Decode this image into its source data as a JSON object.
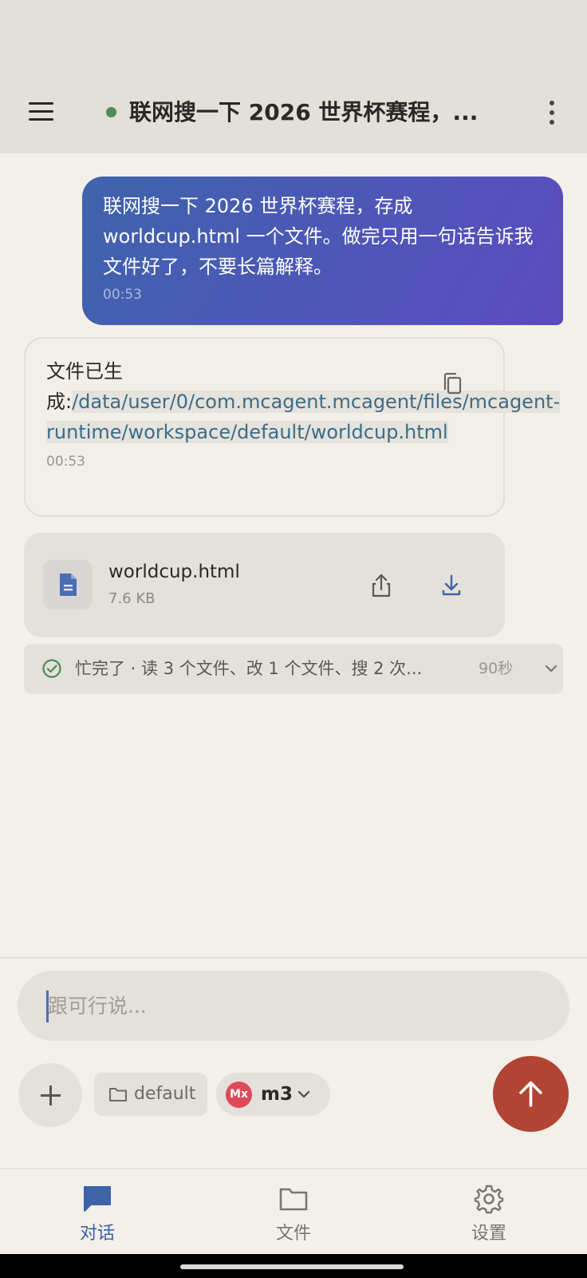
{
  "header": {
    "title": "联网搜一下 2026 世界杯赛程，...",
    "status_color": "#4f8a57"
  },
  "messages": {
    "user": {
      "text": "联网搜一下 2026 世界杯赛程，存成 worldcup.html 一个文件。做完只用一句话告诉我文件好了，不要长篇解释。",
      "time": "00:53"
    },
    "assistant": {
      "prefix": "文件已生成:",
      "path": "/data/user/0/com.mcagent.mcagent/files/mcagent-runtime/workspace/default/worldcup.html",
      "time": "00:53"
    }
  },
  "file_card": {
    "name": "worldcup.html",
    "size": "7.6 KB"
  },
  "activity": {
    "text": "忙完了 · 读 3 个文件、改 1 个文件、搜 2 次...",
    "duration": "90秒"
  },
  "composer": {
    "placeholder": "跟可行说..."
  },
  "toolbar": {
    "workspace": "default",
    "model_badge": "Mx",
    "model_name": "m3"
  },
  "nav": {
    "chat": "对话",
    "files": "文件",
    "settings": "设置"
  },
  "colors": {
    "accent": "#3f63a8",
    "send": "#b14432",
    "model_badge": "#de4a5a"
  }
}
